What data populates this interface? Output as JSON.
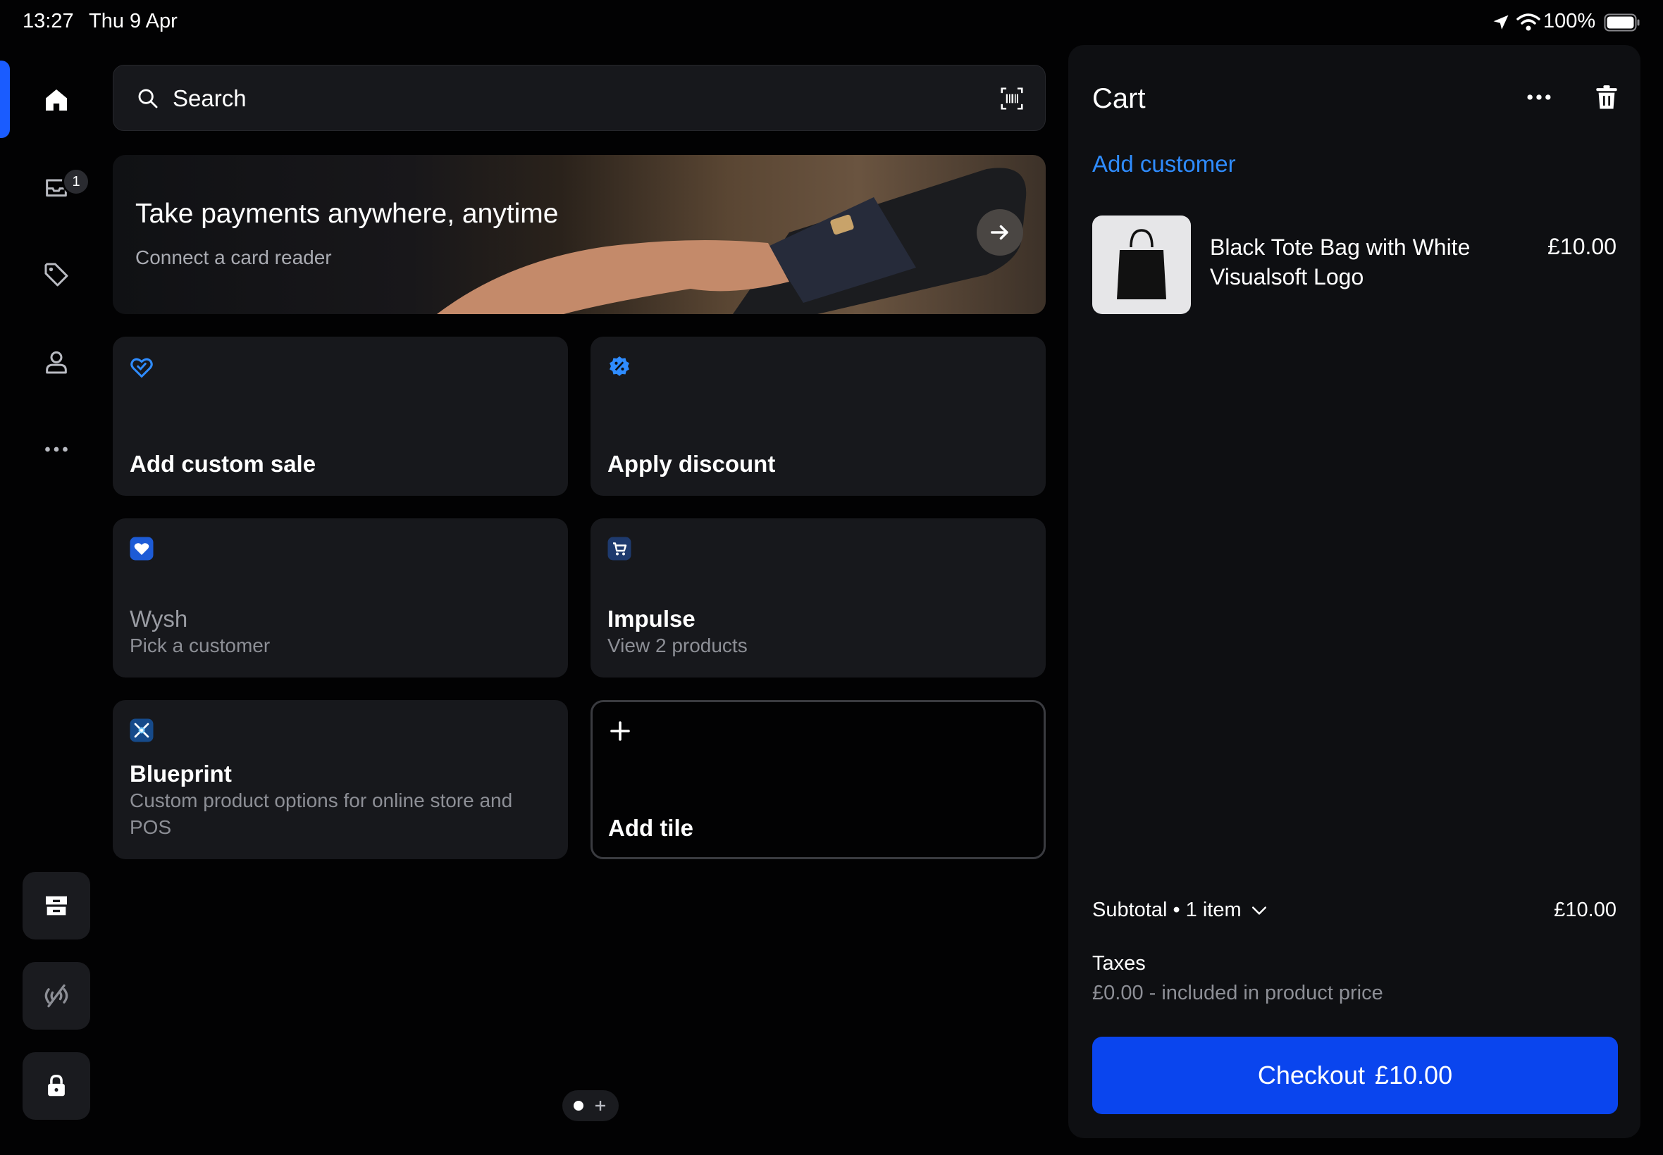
{
  "status_bar": {
    "time": "13:27",
    "date": "Thu 9 Apr",
    "battery": "100%",
    "icons": [
      "location-icon",
      "wifi-icon",
      "battery-icon"
    ]
  },
  "sidebar": {
    "items": [
      {
        "name": "home-icon",
        "active": true
      },
      {
        "name": "orders-inbox-icon",
        "badge": "1"
      },
      {
        "name": "tag-icon"
      },
      {
        "name": "person-icon"
      },
      {
        "name": "more-icon"
      }
    ],
    "bottom_buttons": [
      "store-icon",
      "reader-off-icon",
      "lock-icon"
    ]
  },
  "search": {
    "label": "Search",
    "scan_icon": "barcode-scan-icon"
  },
  "banner": {
    "title": "Take payments anywhere, anytime",
    "subtitle": "Connect a card reader"
  },
  "tiles": [
    {
      "title": "Add custom sale",
      "subtitle": "",
      "icon": "custom-sale-icon"
    },
    {
      "title": "Apply discount",
      "subtitle": "",
      "icon": "discount-badge-icon"
    },
    {
      "title": "Wysh",
      "subtitle": "Pick a customer",
      "icon": "wysh-heart-icon"
    },
    {
      "title": "Impulse",
      "subtitle": "View 2 products",
      "icon": "impulse-cart-icon"
    },
    {
      "title": "Blueprint",
      "subtitle": "Custom product options for online store and POS",
      "icon": "blueprint-icon"
    },
    {
      "title": "Add tile",
      "subtitle": "",
      "icon": "plus-icon"
    }
  ],
  "cart": {
    "title": "Cart",
    "add_customer": "Add customer",
    "items": [
      {
        "name": "Black Tote Bag with White Visualsoft Logo",
        "price": "£10.00"
      }
    ],
    "subtotal_label": "Subtotal • 1 item",
    "subtotal_value": "£10.00",
    "taxes_label": "Taxes",
    "taxes_detail": "£0.00 - included in product price",
    "checkout_label": "Checkout",
    "checkout_amount": "£10.00"
  },
  "colors": {
    "accent": "#0a45ee",
    "link": "#2f8cff",
    "background": "#020203",
    "panel": "#0e0f12",
    "tile": "#17181c"
  }
}
